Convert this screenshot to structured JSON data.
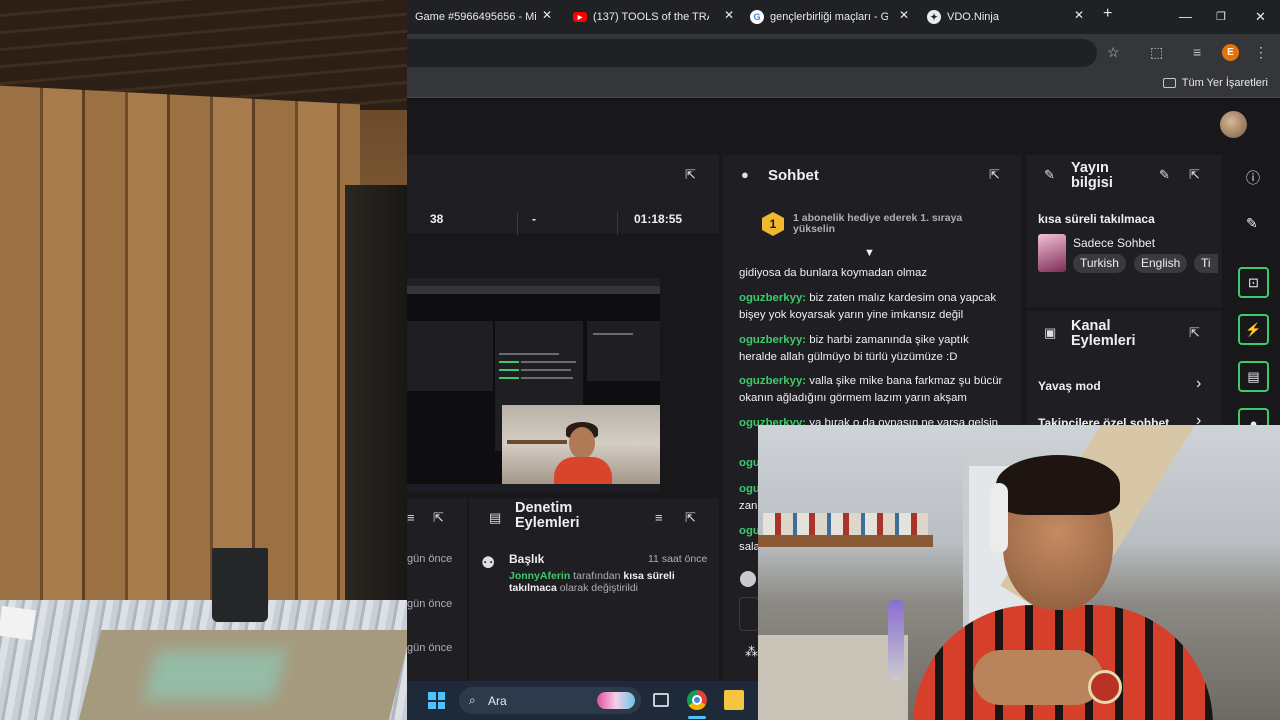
{
  "tabs": [
    {
      "title": "Game #5966495656 - Min…",
      "favicon": "minecraft-icon"
    },
    {
      "title": "(137) TOOLS of the TRADE",
      "favicon": "youtube-icon"
    },
    {
      "title": "gençlerbirliği maçları - Goo…",
      "favicon": "google-icon"
    },
    {
      "title": "VDO.Ninja",
      "favicon": "vdo-ninja-icon"
    }
  ],
  "browser": {
    "bookmarks_label": "Tüm Yer İşaretleri",
    "profile_initial": "E",
    "new_tab_symbol": "+"
  },
  "stats": {
    "viewers": "38",
    "followers": "-",
    "uptime": "01:18:55"
  },
  "chat": {
    "title": "Sohbet",
    "rank_badge": "1",
    "rank_text": "1 abonelik hediye ederek 1. sıraya yükselin",
    "messages": [
      {
        "user": "",
        "text": "gidiyosa da bunlara koymadan olmaz"
      },
      {
        "user": "oguzberkyy:",
        "text": " biz zaten malız kardesim ona yapcak bişey yok koyarsak yarın yine imkansız değil"
      },
      {
        "user": "oguzberkyy:",
        "text": " biz harbi zamanında şike yaptık heralde allah gülmüyo bi türlü yüzümüze :D"
      },
      {
        "user": "oguzberkyy:",
        "text": " valla şike mike bana farkmaz şu bücür okanın ağladığını görmem lazım yarın akşam"
      },
      {
        "user": "oguzberkyy:",
        "text": " ya bırak o da oynasın ne varsa gelsin"
      }
    ],
    "partial_lines": [
      "ogu",
      "ogu",
      "zan",
      "ogu",
      "sala"
    ]
  },
  "stream_info": {
    "title": "Yayın bilgisi",
    "stream_title": "kısa süreli takılmaca",
    "category": "Sadece Sohbet",
    "tags": [
      "Turkish",
      "English",
      "Ti"
    ]
  },
  "channel_actions": {
    "title": "Kanal Eylemleri",
    "items": [
      "Yavaş mod",
      "Takipçilere özel sohbet"
    ]
  },
  "moderation": {
    "title": "Denetim Eylemleri",
    "entry_title": "Başlık",
    "entry_time": "11 saat önce",
    "entry_user": "JonnyAferin",
    "entry_mid": " tarafından ",
    "entry_value": "kısa süreli takılmaca",
    "entry_end": " olarak değiştirildi",
    "left_times": [
      "gün önce",
      "gün önce",
      "gün önce"
    ]
  },
  "taskbar": {
    "search_label": "Ara"
  },
  "colors": {
    "accent_green": "#3ec96b",
    "twitch_bg": "#18181b",
    "panel_bg": "#1f1f23",
    "badge_gold": "#f0b72f"
  }
}
